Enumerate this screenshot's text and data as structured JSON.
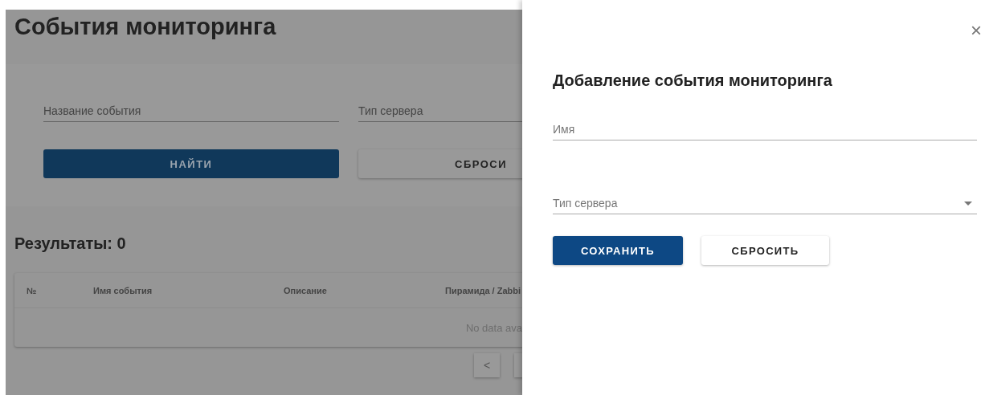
{
  "page": {
    "title": "События мониторинга"
  },
  "filters": {
    "fields": [
      {
        "placeholder": "Название события"
      },
      {
        "placeholder": "Тип сервера"
      }
    ],
    "buttons": [
      {
        "label": "НАЙТИ",
        "kind": "primary"
      },
      {
        "label": "СБРОСИ",
        "kind": "secondary"
      }
    ]
  },
  "results": {
    "title": "Результаты: 0",
    "table": {
      "columns": [
        "№",
        "Имя события",
        "Описание",
        "Пирамида / Zabbi"
      ],
      "empty_text": "No data ava"
    },
    "pagination": {
      "prev": "<"
    }
  },
  "drawer": {
    "close": "×",
    "title": "Добавление события мониторинга",
    "fields": [
      {
        "placeholder": "Имя",
        "kind": "text"
      },
      {
        "placeholder": "Тип сервера",
        "kind": "select"
      }
    ],
    "buttons": [
      {
        "label": "СОХРАНИТЬ",
        "kind": "primary"
      },
      {
        "label": "СБРОСИТЬ",
        "kind": "secondary"
      }
    ]
  }
}
